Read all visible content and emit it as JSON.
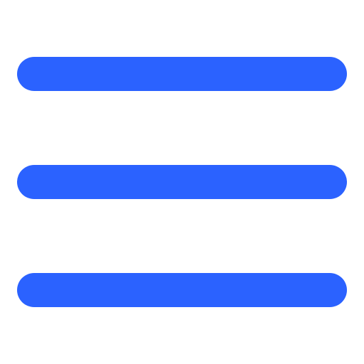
{
  "icon": {
    "name": "hamburger-menu-icon",
    "color": "#2B62FF",
    "background": "#FFFFFF",
    "bar_count": 3
  }
}
